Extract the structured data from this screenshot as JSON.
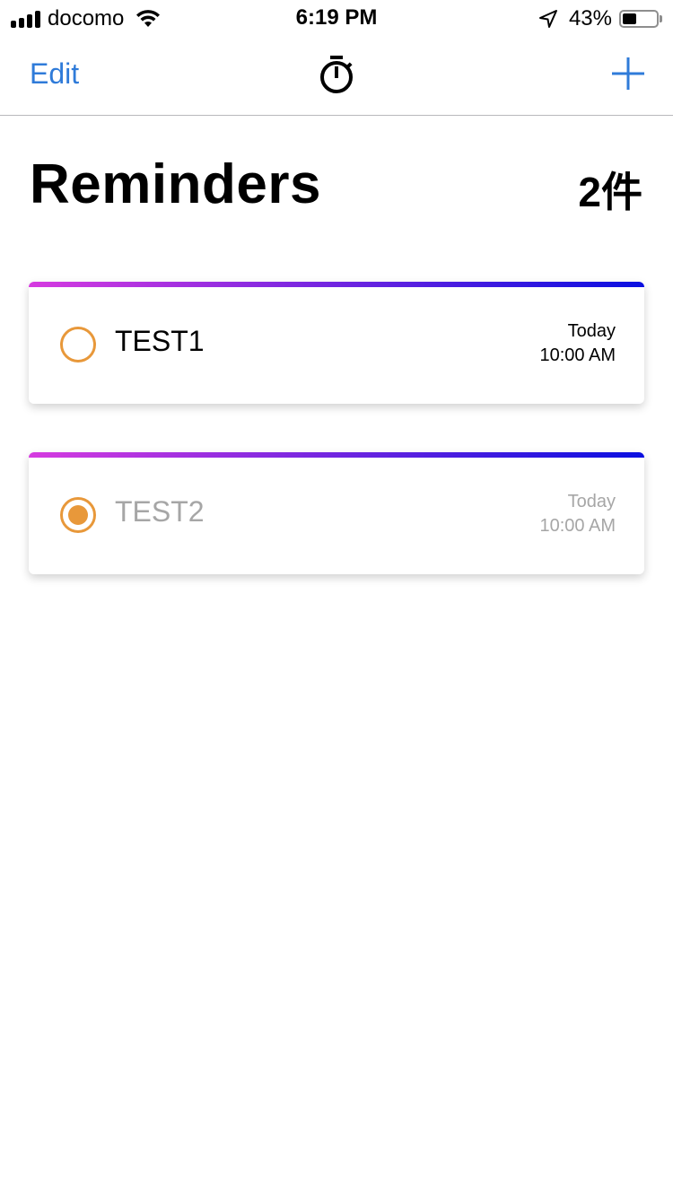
{
  "status_bar": {
    "carrier": "docomo",
    "time": "6:19 PM",
    "battery_percent": "43%",
    "battery_level": 0.43
  },
  "nav": {
    "edit_label": "Edit",
    "center_icon": "stopwatch-icon",
    "right_icon": "plus-icon",
    "accent_color": "#2f7bd9"
  },
  "header": {
    "title": "Reminders",
    "count": "2件"
  },
  "colors": {
    "gradient_start": "#d63be0",
    "gradient_end": "#0a0fe0",
    "radio": "#e8983a",
    "completed_text": "#a6a6a6"
  },
  "reminders": [
    {
      "title": "TEST1",
      "day": "Today",
      "time": "10:00 AM",
      "completed": false
    },
    {
      "title": "TEST2",
      "day": "Today",
      "time": "10:00 AM",
      "completed": true
    }
  ]
}
